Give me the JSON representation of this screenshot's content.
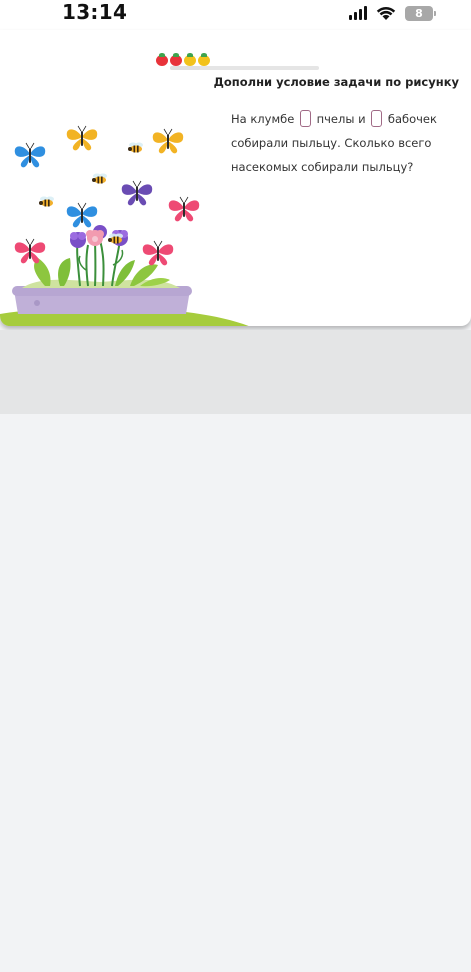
{
  "status_bar": {
    "time": "13:14",
    "battery": "8"
  },
  "progress": {
    "fruit_colors": [
      "#e8333a",
      "#e8333a",
      "#f2c21b",
      "#f2c21b"
    ],
    "fill_fraction": 0.2
  },
  "task": {
    "title": "Дополни условие задачи по рисунку",
    "text_part1": "На клумбе",
    "text_part2": "пчелы и",
    "text_part3": "бабочек собирали пыльцу. Сколько всего насекомых собирали пыльцу?"
  },
  "colors": {
    "background": "#f2f3f5",
    "card": "#ffffff",
    "gray_band": "#e4e5e6",
    "blank_border": "#a06a86"
  }
}
